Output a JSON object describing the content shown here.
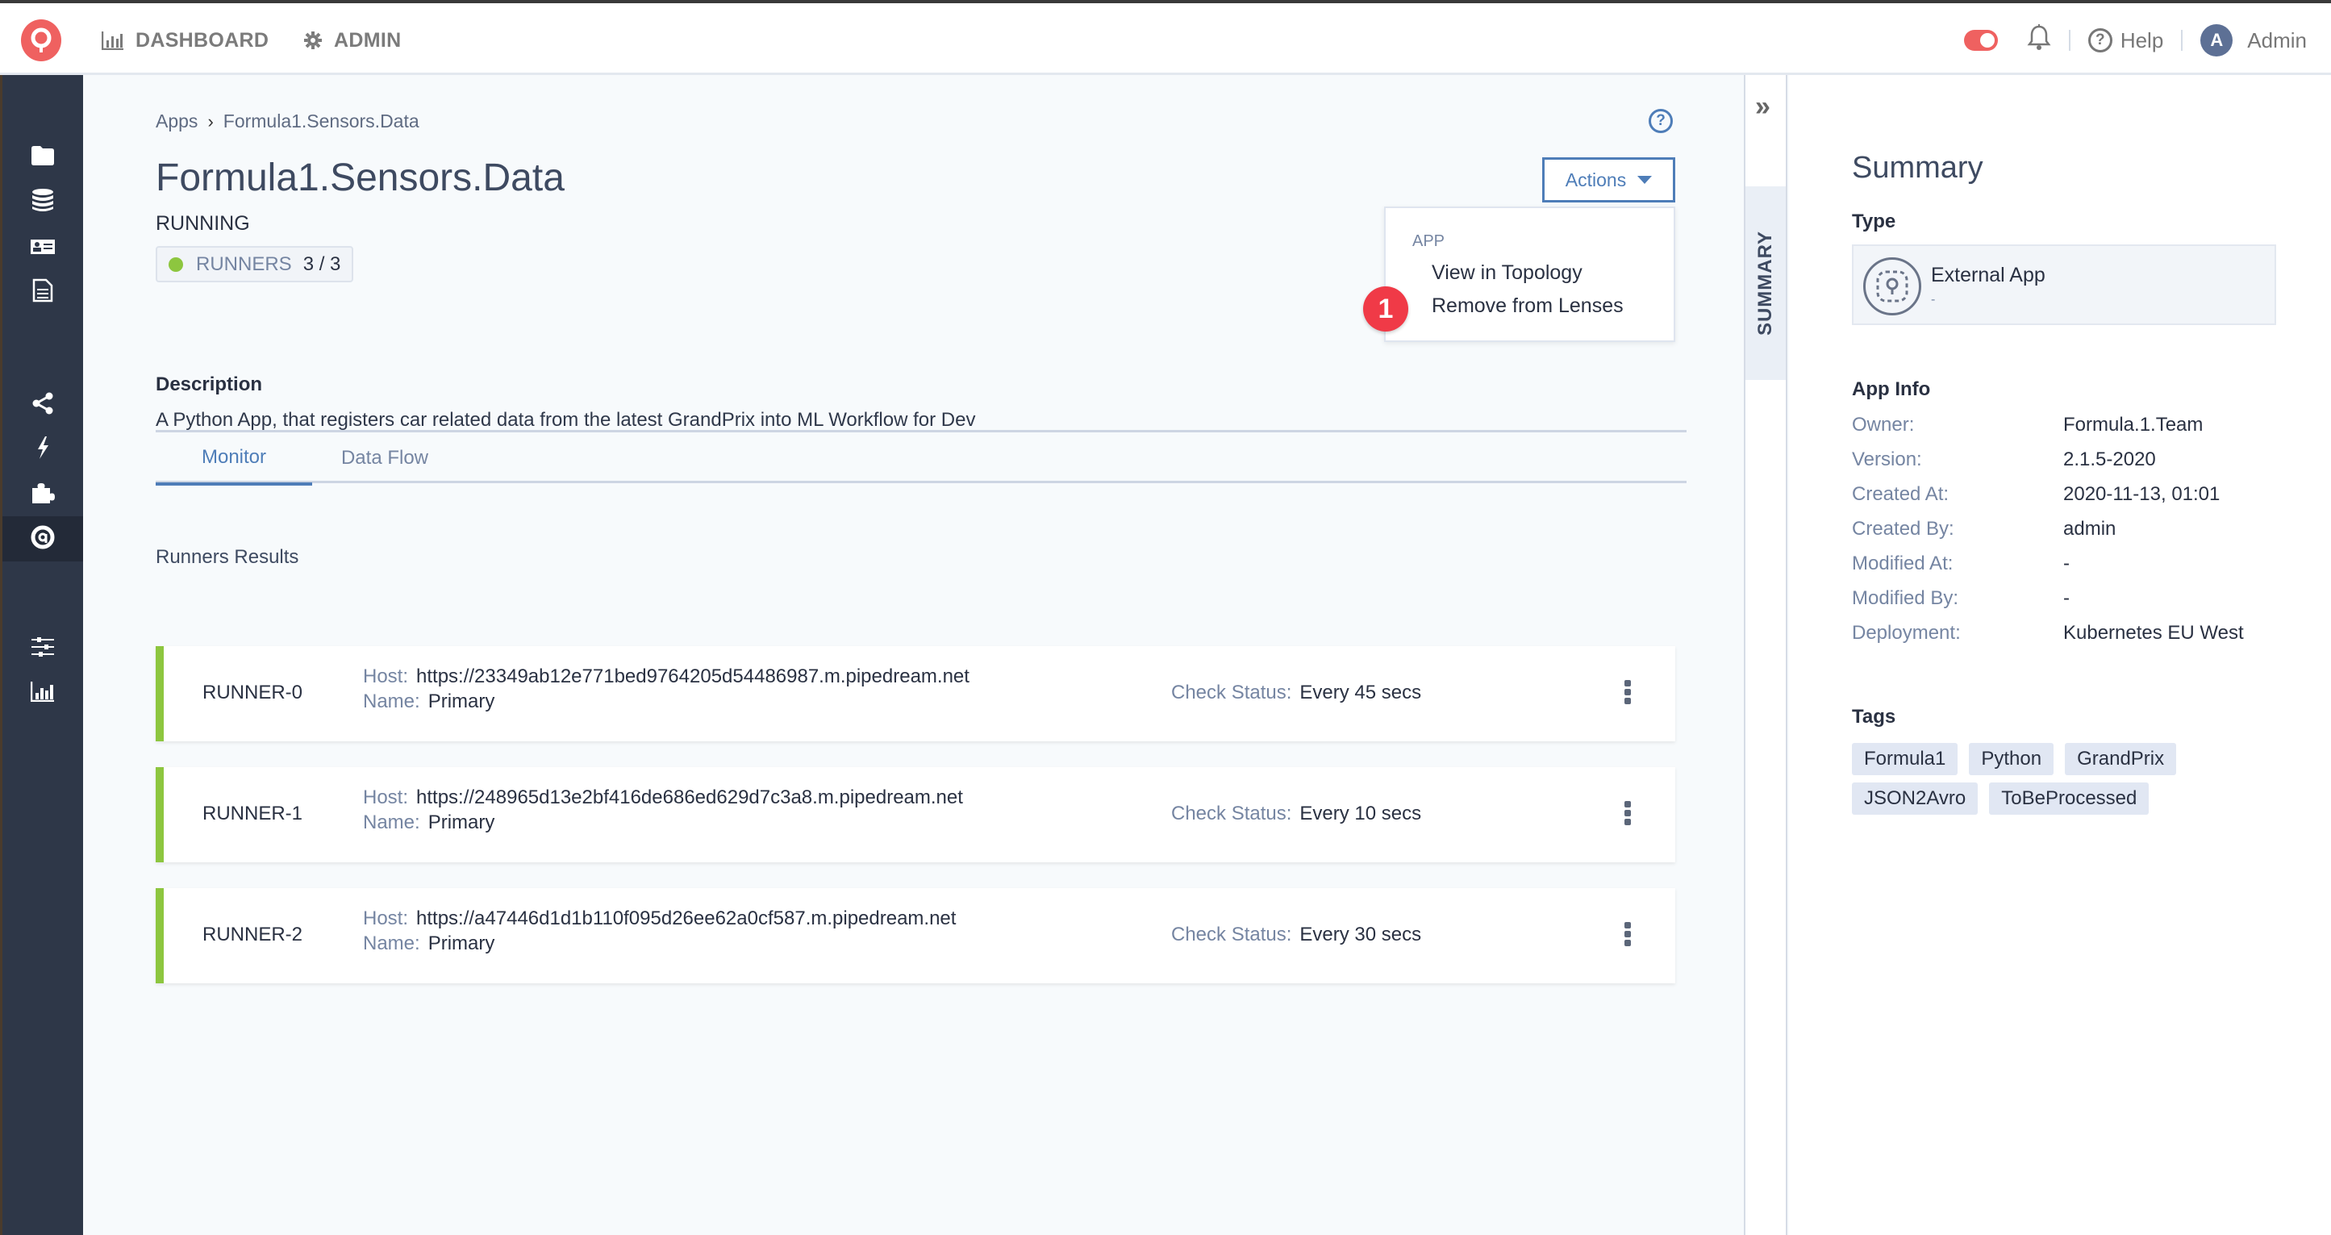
{
  "header": {
    "nav": [
      {
        "label": "DASHBOARD",
        "icon": "bar-chart-icon"
      },
      {
        "label": "ADMIN",
        "icon": "gear-icon"
      }
    ],
    "help_label": "Help",
    "user": {
      "initial": "A",
      "name": "Admin"
    }
  },
  "sidebar": {
    "items": [
      {
        "icon": "folder-icon"
      },
      {
        "icon": "database-icon"
      },
      {
        "icon": "id-card-icon"
      },
      {
        "icon": "document-icon"
      },
      {
        "icon": "share-icon"
      },
      {
        "icon": "lightning-icon"
      },
      {
        "icon": "puzzle-icon"
      },
      {
        "icon": "apps-icon",
        "active": true
      },
      {
        "icon": "sliders-icon"
      },
      {
        "icon": "bar-chart-icon"
      }
    ]
  },
  "breadcrumb": {
    "root": "Apps",
    "current": "Formula1.Sensors.Data"
  },
  "app": {
    "title": "Formula1.Sensors.Data",
    "status": "RUNNING",
    "runners_label": "RUNNERS",
    "runners_value": "3 / 3",
    "runners_status_color": "#8dc63f",
    "description_label": "Description",
    "description": "A Python App, that registers car related data from the latest GrandPrix into ML Workflow for Dev"
  },
  "actions": {
    "button_label": "Actions",
    "menu_group": "APP",
    "menu_items": [
      "View in Topology",
      "Remove from Lenses"
    ],
    "step_badge": "1"
  },
  "tabs": [
    {
      "label": "Monitor",
      "active": true
    },
    {
      "label": "Data Flow",
      "active": false
    }
  ],
  "runners_section": {
    "title": "Runners Results",
    "host_key": "Host:",
    "name_key": "Name:",
    "check_key": "Check Status:",
    "runners": [
      {
        "id": "RUNNER-0",
        "host": "https://23349ab12e771bed9764205d54486987.m.pipedream.net",
        "name": "Primary",
        "check": "Every 45 secs"
      },
      {
        "id": "RUNNER-1",
        "host": "https://248965d13e2bf416de686ed629d7c3a8.m.pipedream.net",
        "name": "Primary",
        "check": "Every 10 secs"
      },
      {
        "id": "RUNNER-2",
        "host": "https://a47446d1d1b110f095d26ee62a0cf587.m.pipedream.net",
        "name": "Primary",
        "check": "Every 30 secs"
      }
    ]
  },
  "summary_panel": {
    "tab_label": "SUMMARY",
    "title": "Summary",
    "type_label": "Type",
    "type_name": "External App",
    "type_sub": "-",
    "app_info_label": "App Info",
    "info": [
      {
        "key": "Owner:",
        "value": "Formula.1.Team"
      },
      {
        "key": "Version:",
        "value": "2.1.5-2020"
      },
      {
        "key": "Created At:",
        "value": "2020-11-13, 01:01"
      },
      {
        "key": "Created By:",
        "value": "admin"
      },
      {
        "key": "Modified At:",
        "value": "-"
      },
      {
        "key": "Modified By:",
        "value": "-"
      },
      {
        "key": "Deployment:",
        "value": "Kubernetes EU West"
      }
    ],
    "tags_label": "Tags",
    "tags": [
      "Formula1",
      "Python",
      "GrandPrix",
      "JSON2Avro",
      "ToBeProcessed"
    ]
  },
  "colors": {
    "brand": "#ef6160",
    "accent": "#4e7db8",
    "sidebar_bg": "#2e3748",
    "runner_ok": "#8dc63f",
    "step_badge": "#f03a47"
  }
}
